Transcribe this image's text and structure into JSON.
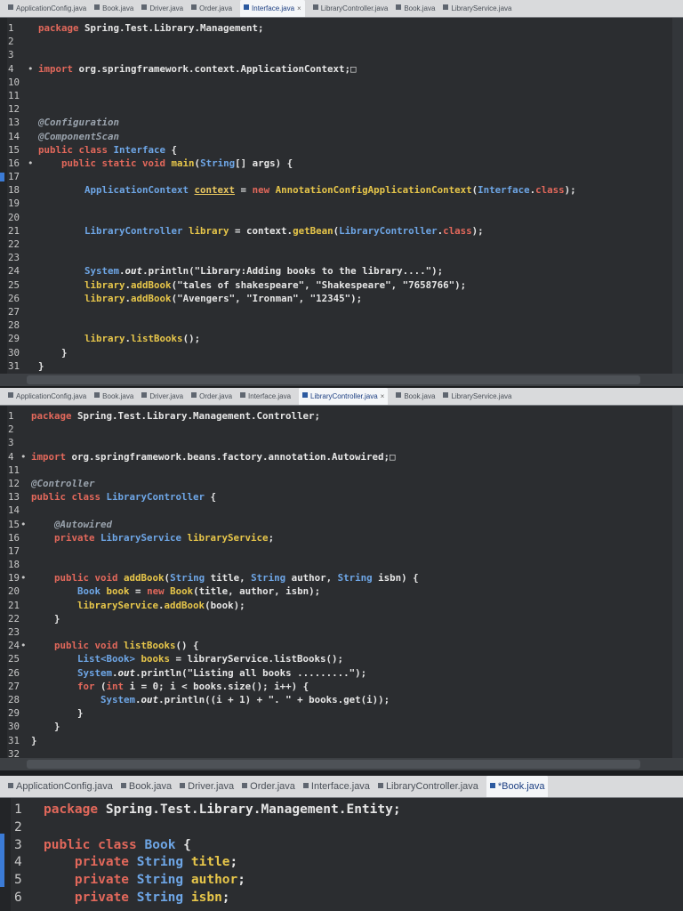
{
  "editors": [
    {
      "tabs": [
        {
          "label": "ApplicationConfig.java",
          "active": false
        },
        {
          "label": "Book.java",
          "active": false
        },
        {
          "label": "Driver.java",
          "active": false
        },
        {
          "label": "Order.java",
          "active": false
        },
        {
          "label": "Interface.java",
          "active": true,
          "close": "×"
        },
        {
          "label": "LibraryController.java",
          "active": false
        },
        {
          "label": "Book.java",
          "active": false
        },
        {
          "label": "LibraryService.java",
          "active": false
        }
      ],
      "lines": [
        {
          "n": "1",
          "tokens": [
            [
              "k",
              "package "
            ],
            [
              "",
              "Spring.Test.Library.Management;"
            ]
          ]
        },
        {
          "n": "2",
          "tokens": []
        },
        {
          "n": "3",
          "tokens": []
        },
        {
          "n": "4",
          "marker": "•",
          "tokens": [
            [
              "k",
              "import "
            ],
            [
              "",
              "org.springframework.context.ApplicationContext;□"
            ]
          ]
        },
        {
          "n": "10",
          "tokens": []
        },
        {
          "n": "11",
          "tokens": []
        },
        {
          "n": "12",
          "tokens": []
        },
        {
          "n": "13",
          "tokens": [
            [
              "a",
              "@Configuration"
            ]
          ]
        },
        {
          "n": "14",
          "tokens": [
            [
              "a",
              "@ComponentScan"
            ]
          ]
        },
        {
          "n": "15",
          "tokens": [
            [
              "k",
              "public class "
            ],
            [
              "t",
              "Interface"
            ],
            [
              "",
              " {"
            ]
          ]
        },
        {
          "n": "16",
          "marker": "•",
          "tokens": [
            [
              "",
              "    "
            ],
            [
              "k",
              "public static void "
            ],
            [
              "m",
              "main"
            ],
            [
              "",
              "("
            ],
            [
              "t",
              "String"
            ],
            [
              "",
              "[] args) {"
            ]
          ]
        },
        {
          "n": "17",
          "tokens": []
        },
        {
          "n": "18",
          "tokens": [
            [
              "",
              "        "
            ],
            [
              "t",
              "ApplicationContext "
            ],
            [
              "fd",
              "context"
            ],
            [
              "",
              " = "
            ],
            [
              "k",
              "new "
            ],
            [
              "m",
              "AnnotationConfigApplicationContext"
            ],
            [
              "",
              "("
            ],
            [
              "t",
              "Interface"
            ],
            [
              "",
              "."
            ],
            [
              "k",
              "class"
            ],
            [
              "",
              ");"
            ]
          ]
        },
        {
          "n": "19",
          "tokens": []
        },
        {
          "n": "20",
          "tokens": []
        },
        {
          "n": "21",
          "tokens": [
            [
              "",
              "        "
            ],
            [
              "t",
              "LibraryController "
            ],
            [
              "m",
              "library"
            ],
            [
              "",
              " = context."
            ],
            [
              "m",
              "getBean"
            ],
            [
              "",
              "("
            ],
            [
              "t",
              "LibraryController"
            ],
            [
              "",
              "."
            ],
            [
              "k",
              "class"
            ],
            [
              "",
              ");"
            ]
          ]
        },
        {
          "n": "22",
          "tokens": []
        },
        {
          "n": "23",
          "tokens": []
        },
        {
          "n": "24",
          "tokens": [
            [
              "",
              "        "
            ],
            [
              "t",
              "System"
            ],
            [
              "",
              "."
            ],
            [
              "f",
              "out"
            ],
            [
              "",
              ".println(\"Library:Adding books to the library....\");"
            ]
          ]
        },
        {
          "n": "25",
          "tokens": [
            [
              "",
              "        "
            ],
            [
              "m",
              "library"
            ],
            [
              "",
              "."
            ],
            [
              "m",
              "addBook"
            ],
            [
              "",
              "(\"tales of shakespeare\", \"Shakespeare\", \"7658766\");"
            ]
          ]
        },
        {
          "n": "26",
          "tokens": [
            [
              "",
              "        "
            ],
            [
              "m",
              "library"
            ],
            [
              "",
              "."
            ],
            [
              "m",
              "addBook"
            ],
            [
              "",
              "(\"Avengers\", \"Ironman\", \"12345\");"
            ]
          ]
        },
        {
          "n": "27",
          "tokens": []
        },
        {
          "n": "28",
          "tokens": []
        },
        {
          "n": "29",
          "tokens": [
            [
              "",
              "        "
            ],
            [
              "m",
              "library"
            ],
            [
              "",
              "."
            ],
            [
              "m",
              "listBooks"
            ],
            [
              "",
              "();"
            ]
          ]
        },
        {
          "n": "30",
          "tokens": [
            [
              "",
              "    }"
            ]
          ]
        },
        {
          "n": "31",
          "tokens": [
            [
              "",
              "}"
            ]
          ]
        }
      ]
    },
    {
      "tabs": [
        {
          "label": "ApplicationConfig.java",
          "active": false
        },
        {
          "label": "Book.java",
          "active": false
        },
        {
          "label": "Driver.java",
          "active": false
        },
        {
          "label": "Order.java",
          "active": false
        },
        {
          "label": "Interface.java",
          "active": false
        },
        {
          "label": "LibraryController.java",
          "active": true,
          "close": "×"
        },
        {
          "label": "Book.java",
          "active": false
        },
        {
          "label": "LibraryService.java",
          "active": false
        }
      ],
      "lines": [
        {
          "n": "1",
          "tokens": [
            [
              "k",
              "package "
            ],
            [
              "",
              "Spring.Test.Library.Management.Controller;"
            ]
          ]
        },
        {
          "n": "2",
          "tokens": []
        },
        {
          "n": "3",
          "tokens": []
        },
        {
          "n": "4",
          "marker": "•",
          "tokens": [
            [
              "k",
              "import "
            ],
            [
              "",
              "org.springframework.beans.factory.annotation.Autowired;□"
            ]
          ]
        },
        {
          "n": "11",
          "tokens": []
        },
        {
          "n": "12",
          "tokens": [
            [
              "a",
              "@Controller"
            ]
          ]
        },
        {
          "n": "13",
          "tokens": [
            [
              "k",
              "public class "
            ],
            [
              "t",
              "LibraryController"
            ],
            [
              "",
              " {"
            ]
          ]
        },
        {
          "n": "14",
          "tokens": []
        },
        {
          "n": "15",
          "marker": "•",
          "tokens": [
            [
              "",
              "    "
            ],
            [
              "a",
              "@Autowired"
            ]
          ]
        },
        {
          "n": "16",
          "tokens": [
            [
              "",
              "    "
            ],
            [
              "k",
              "private "
            ],
            [
              "t",
              "LibraryService "
            ],
            [
              "m",
              "libraryService"
            ],
            [
              "",
              ";"
            ]
          ]
        },
        {
          "n": "17",
          "tokens": []
        },
        {
          "n": "18",
          "tokens": []
        },
        {
          "n": "19",
          "marker": "•",
          "tokens": [
            [
              "",
              "    "
            ],
            [
              "k",
              "public void "
            ],
            [
              "m",
              "addBook"
            ],
            [
              "",
              "("
            ],
            [
              "t",
              "String"
            ],
            [
              "",
              " title, "
            ],
            [
              "t",
              "String"
            ],
            [
              "",
              " author, "
            ],
            [
              "t",
              "String"
            ],
            [
              "",
              " isbn) {"
            ]
          ]
        },
        {
          "n": "20",
          "tokens": [
            [
              "",
              "        "
            ],
            [
              "t",
              "Book "
            ],
            [
              "m",
              "book"
            ],
            [
              "",
              " = "
            ],
            [
              "k",
              "new "
            ],
            [
              "m",
              "Book"
            ],
            [
              "",
              "(title, author, isbn);"
            ]
          ]
        },
        {
          "n": "21",
          "tokens": [
            [
              "",
              "        "
            ],
            [
              "m",
              "libraryService"
            ],
            [
              "",
              "."
            ],
            [
              "m",
              "addBook"
            ],
            [
              "",
              "(book);"
            ]
          ]
        },
        {
          "n": "22",
          "tokens": [
            [
              "",
              "    }"
            ]
          ]
        },
        {
          "n": "23",
          "tokens": []
        },
        {
          "n": "24",
          "marker": "•",
          "tokens": [
            [
              "",
              "    "
            ],
            [
              "k",
              "public void "
            ],
            [
              "m",
              "listBooks"
            ],
            [
              "",
              "() {"
            ]
          ]
        },
        {
          "n": "25",
          "tokens": [
            [
              "",
              "        "
            ],
            [
              "t",
              "List<Book> "
            ],
            [
              "m",
              "books"
            ],
            [
              "",
              " = libraryService.listBooks();"
            ]
          ]
        },
        {
          "n": "26",
          "tokens": [
            [
              "",
              "        "
            ],
            [
              "t",
              "System"
            ],
            [
              "",
              "."
            ],
            [
              "f",
              "out"
            ],
            [
              "",
              ".println(\"Listing all books .........\");"
            ]
          ]
        },
        {
          "n": "27",
          "tokens": [
            [
              "",
              "        "
            ],
            [
              "k",
              "for "
            ],
            [
              "",
              "("
            ],
            [
              "k",
              "int "
            ],
            [
              "",
              "i = 0; i < books.size(); i++) {"
            ]
          ]
        },
        {
          "n": "28",
          "tokens": [
            [
              "",
              "            "
            ],
            [
              "t",
              "System"
            ],
            [
              "",
              "."
            ],
            [
              "f",
              "out"
            ],
            [
              "",
              ".println((i + 1) + \". \" + books.get(i));"
            ]
          ]
        },
        {
          "n": "29",
          "tokens": [
            [
              "",
              "        }"
            ]
          ]
        },
        {
          "n": "30",
          "tokens": [
            [
              "",
              "    }"
            ]
          ]
        },
        {
          "n": "31",
          "tokens": [
            [
              "",
              "}"
            ]
          ]
        },
        {
          "n": "32",
          "tokens": []
        }
      ]
    },
    {
      "tabs": [
        {
          "label": "ApplicationConfig.java",
          "active": false
        },
        {
          "label": "Book.java",
          "active": false
        },
        {
          "label": "Driver.java",
          "active": false
        },
        {
          "label": "Order.java",
          "active": false
        },
        {
          "label": "Interface.java",
          "active": false
        },
        {
          "label": "LibraryController.java",
          "active": false
        },
        {
          "label": "*Book.java",
          "active": true
        }
      ],
      "lines": [
        {
          "n": "1",
          "tokens": [
            [
              "k",
              "package "
            ],
            [
              "",
              "Spring.Test.Library.Management.Entity;"
            ]
          ]
        },
        {
          "n": "2",
          "tokens": []
        },
        {
          "n": "3",
          "tokens": [
            [
              "k",
              "public class "
            ],
            [
              "t",
              "Book"
            ],
            [
              "",
              " {"
            ]
          ]
        },
        {
          "n": "4",
          "tokens": [
            [
              "",
              "    "
            ],
            [
              "k",
              "private "
            ],
            [
              "t",
              "String "
            ],
            [
              "m",
              "title"
            ],
            [
              "",
              ";"
            ]
          ]
        },
        {
          "n": "5",
          "tokens": [
            [
              "",
              "    "
            ],
            [
              "k",
              "private "
            ],
            [
              "t",
              "String "
            ],
            [
              "m",
              "author"
            ],
            [
              "",
              ";"
            ]
          ]
        },
        {
          "n": "6",
          "tokens": [
            [
              "",
              "    "
            ],
            [
              "k",
              "private "
            ],
            [
              "t",
              "String "
            ],
            [
              "m",
              "isbn"
            ],
            [
              "",
              ";"
            ]
          ]
        }
      ]
    }
  ]
}
